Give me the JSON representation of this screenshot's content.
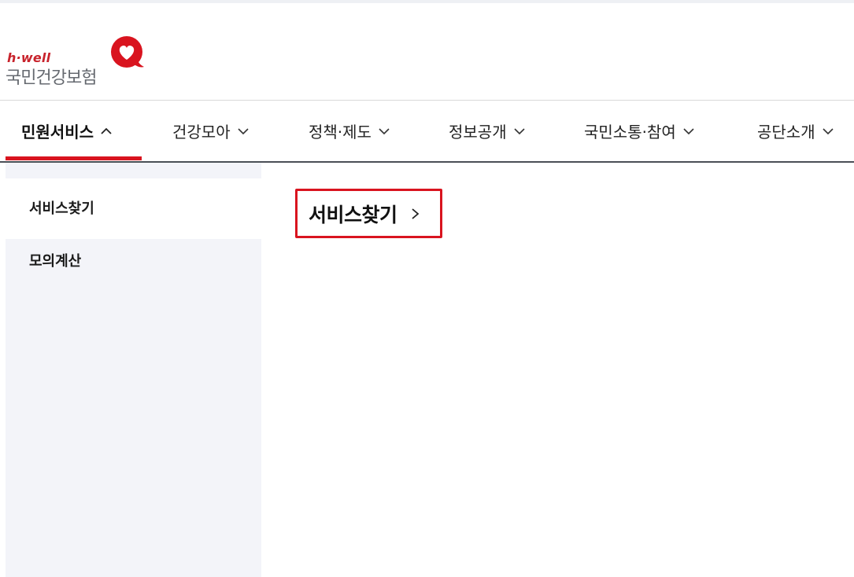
{
  "logo": {
    "subtitle": "h·well",
    "name": "국민건강보험",
    "colors": {
      "red": "#c8232c",
      "gray": "#666a70"
    }
  },
  "gnb": {
    "items": [
      {
        "label": "민원서비스",
        "state": "expanded",
        "icon": "chevron-up-icon"
      },
      {
        "label": "건강모아",
        "state": "collapsed",
        "icon": "chevron-down-icon"
      },
      {
        "label": "정책·제도",
        "state": "collapsed",
        "icon": "chevron-down-icon"
      },
      {
        "label": "정보공개",
        "state": "collapsed",
        "icon": "chevron-down-icon"
      },
      {
        "label": "국민소통·참여",
        "state": "collapsed",
        "icon": "chevron-down-icon"
      },
      {
        "label": "공단소개",
        "state": "collapsed",
        "icon": "chevron-down-icon"
      }
    ],
    "accent_color": "#d9141f"
  },
  "lnb": {
    "items": [
      {
        "label": "서비스찾기",
        "selected": true
      },
      {
        "label": "모의계산",
        "selected": false
      }
    ]
  },
  "main": {
    "section_link": {
      "label": "서비스찾기",
      "icon": "chevron-right-icon"
    }
  }
}
